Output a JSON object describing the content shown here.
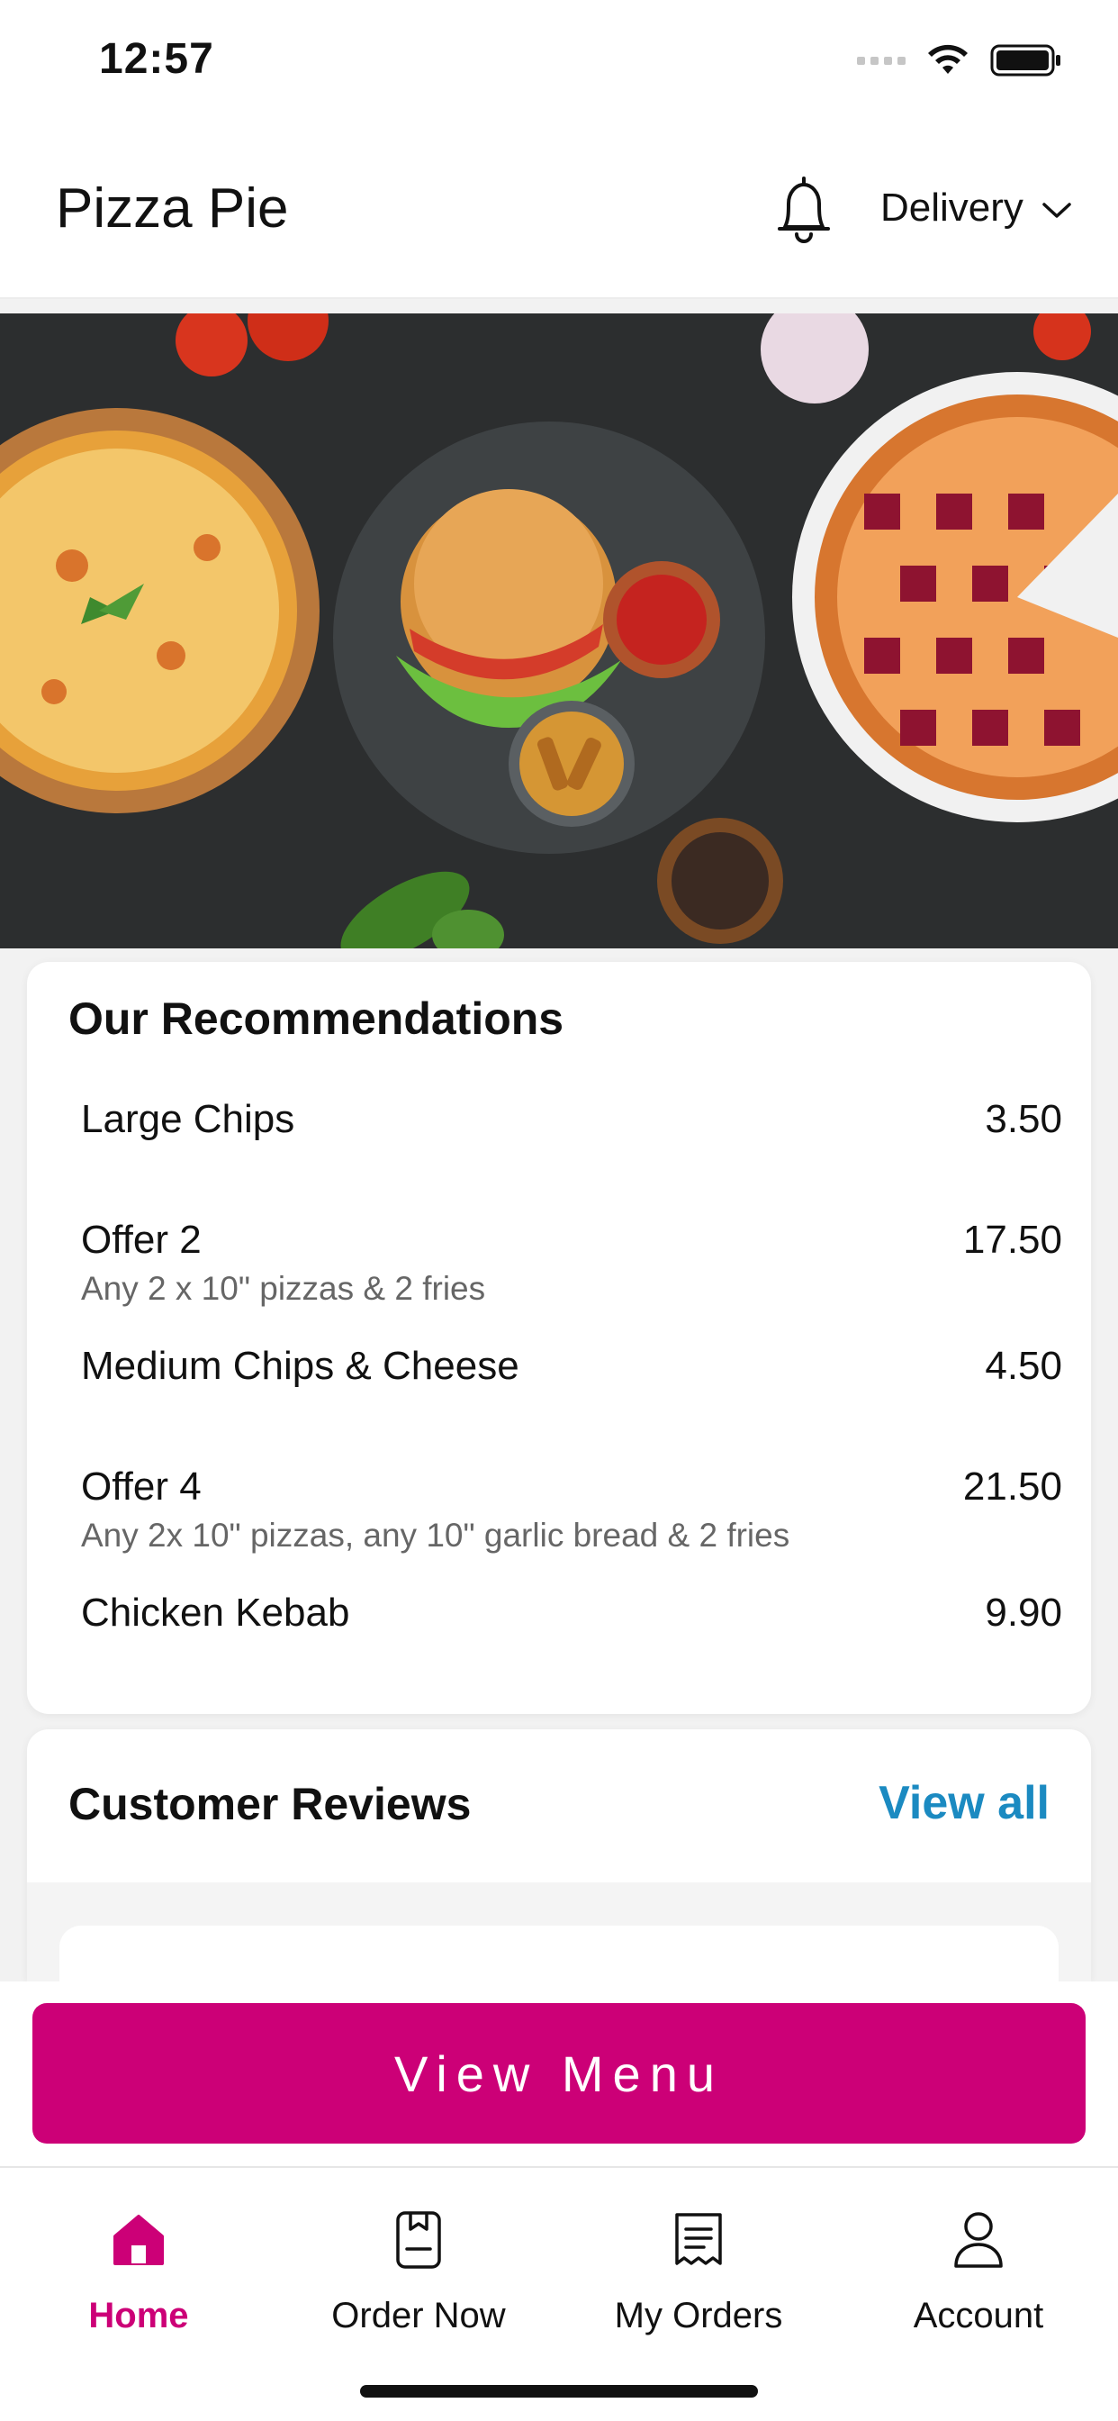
{
  "status_bar": {
    "time": "12:57"
  },
  "header": {
    "brand": "Pizza Pie",
    "mode_label": "Delivery"
  },
  "recommendations": {
    "title": "Our Recommendations",
    "items": [
      {
        "name": "Large Chips",
        "description": "",
        "price": "3.50"
      },
      {
        "name": "Offer 2",
        "description": "Any 2 x 10\" pizzas & 2 fries",
        "price": "17.50"
      },
      {
        "name": "Medium Chips & Cheese",
        "description": "",
        "price": "4.50"
      },
      {
        "name": "Offer 4",
        "description": "Any 2x 10\" pizzas, any 10\" garlic bread & 2 fries",
        "price": "21.50"
      },
      {
        "name": "Chicken Kebab",
        "description": "",
        "price": "9.90"
      }
    ]
  },
  "reviews": {
    "title": "Customer Reviews",
    "view_all_label": "View all"
  },
  "cta": {
    "label": "View Menu"
  },
  "tabbar": {
    "tabs": [
      {
        "label": "Home",
        "icon": "home-icon",
        "active": true
      },
      {
        "label": "Order Now",
        "icon": "order-icon",
        "active": false
      },
      {
        "label": "My Orders",
        "icon": "receipt-icon",
        "active": false
      },
      {
        "label": "Account",
        "icon": "person-icon",
        "active": false
      }
    ]
  },
  "colors": {
    "accent": "#cc0077",
    "link": "#1b8ac1",
    "hero_bg": "#2b2d2e"
  }
}
